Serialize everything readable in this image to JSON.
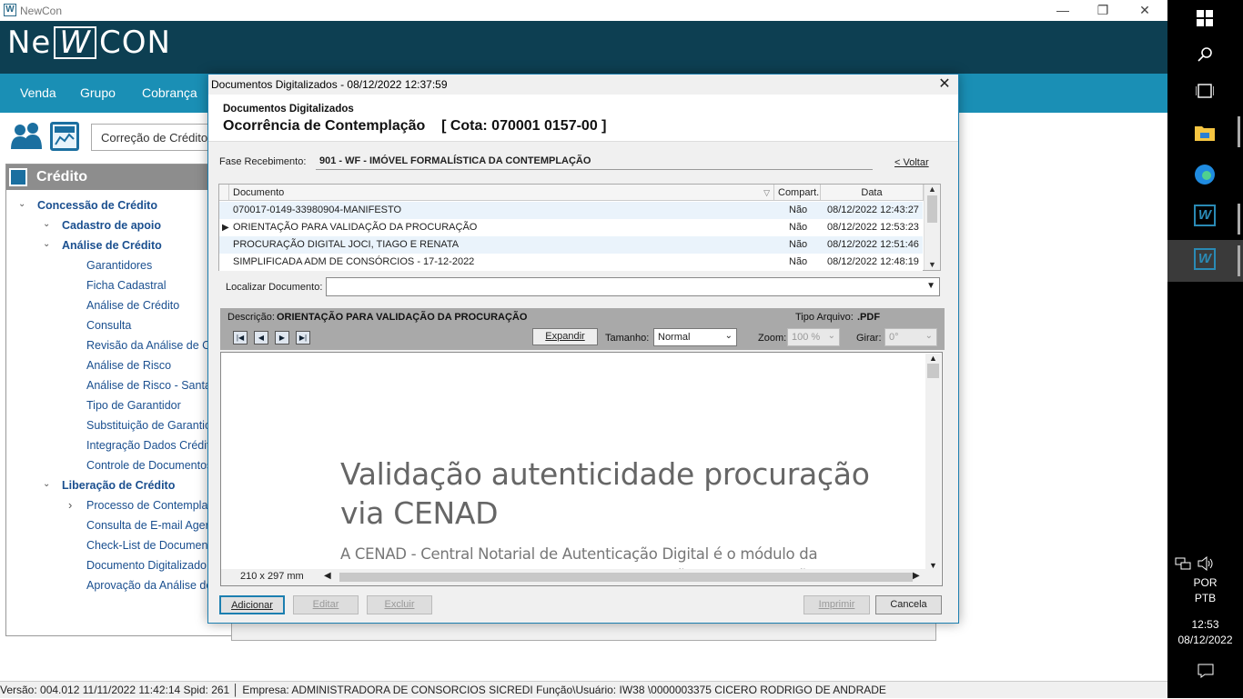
{
  "window": {
    "title": "NewCon",
    "minimize": "—",
    "restore": "❐",
    "close": "✕"
  },
  "logo": {
    "left": "Ne",
    "mid": "W",
    "right": "CON"
  },
  "menu": [
    "Venda",
    "Grupo",
    "Cobrança"
  ],
  "toolbar": {
    "correcao": "Correção de Crédito"
  },
  "tree": {
    "header": "Crédito",
    "items": [
      {
        "label": "Concessão de Crédito",
        "chev": "⌄"
      },
      {
        "label": "Cadastro de apoio",
        "chev": "⌄"
      },
      {
        "label": "Análise de Crédito",
        "chev": "⌄"
      },
      {
        "label": "Garantidores"
      },
      {
        "label": "Ficha Cadastral"
      },
      {
        "label": "Análise de Crédito"
      },
      {
        "label": "Consulta"
      },
      {
        "label": "Revisão da Análise de C"
      },
      {
        "label": "Análise de Risco"
      },
      {
        "label": "Análise de Risco - Santa"
      },
      {
        "label": "Tipo de Garantidor"
      },
      {
        "label": "Substituição de Garantic"
      },
      {
        "label": "Integração Dados Crédit"
      },
      {
        "label": "Controle de Documentos"
      },
      {
        "label": "Liberação de Crédito",
        "chev": "⌄"
      },
      {
        "label": "Processo de Contempla",
        "chev": "›"
      },
      {
        "label": "Consulta de E-mail Ager"
      },
      {
        "label": "Check-List de Documen"
      },
      {
        "label": "Documento Digitalizado"
      },
      {
        "label": "Aprovação da Análise de"
      }
    ]
  },
  "dialog": {
    "title": "Documentos Digitalizados - 08/12/2022  12:37:59",
    "subtitle": "Documentos Digitalizados",
    "main": "Ocorrência de Contemplação    [ Cota: 070001 0157-00 ]",
    "fase_label": "Fase Recebimento:",
    "fase_value": "901 - WF - IMÓVEL FORMALÍSTICA DA CONTEMPLAÇÃO",
    "voltar": "< Voltar",
    "columns": {
      "doc": "Documento",
      "comp": "Compart.",
      "data": "Data"
    },
    "rows": [
      {
        "doc": "070017-0149-33980904-MANIFESTO",
        "comp": "Não",
        "data": "08/12/2022 12:43:27"
      },
      {
        "doc": "ORIENTAÇÃO PARA VALIDAÇÃO DA PROCURAÇÃO",
        "comp": "Não",
        "data": "08/12/2022 12:53:23"
      },
      {
        "doc": "PROCURAÇÃO DIGITAL JOCI, TIAGO E RENATA",
        "comp": "Não",
        "data": "08/12/2022 12:51:46"
      },
      {
        "doc": "SIMPLIFICADA ADM DE CONSÓRCIOS - 17-12-2022",
        "comp": "Não",
        "data": "08/12/2022 12:48:19"
      }
    ],
    "find_label": "Localizar Documento:",
    "desc_label": "Descrição:",
    "desc_value": "ORIENTAÇÃO PARA VALIDAÇÃO DA PROCURAÇÃO",
    "tipo_label": "Tipo Arquivo:",
    "tipo_value": ".PDF",
    "expandir": "Expandir",
    "tamanho_label": "Tamanho:",
    "tamanho_value": "Normal",
    "zoom_label": "Zoom:",
    "zoom_value": "100 %",
    "girar_label": "Girar:",
    "girar_value": "0°",
    "doc_title": "Validação autenticidade procuração via CENAD",
    "doc_body": "A CENAD - Central Notarial de Autenticação Digital é o módulo da plataforma e-Notariado que permite a realização de autenticação digital de documentos",
    "page_size": "210 x 297 mm",
    "buttons": {
      "adicionar": "Adicionar",
      "editar": "Editar",
      "excluir": "Excluir",
      "imprimir": "Imprimir",
      "cancela": "Cancela"
    }
  },
  "status": "Versão: 004.012  11/11/2022 11:42:14  Spid: 261  │ Empresa: ADMINISTRADORA DE CONSORCIOS SICREDI  Função\\Usuário: IW38  \\0000003375 CICERO RODRIGO DE ANDRADE",
  "taskbar": {
    "lang1": "POR",
    "lang2": "PTB",
    "time": "12:53",
    "date": "08/12/2022"
  }
}
